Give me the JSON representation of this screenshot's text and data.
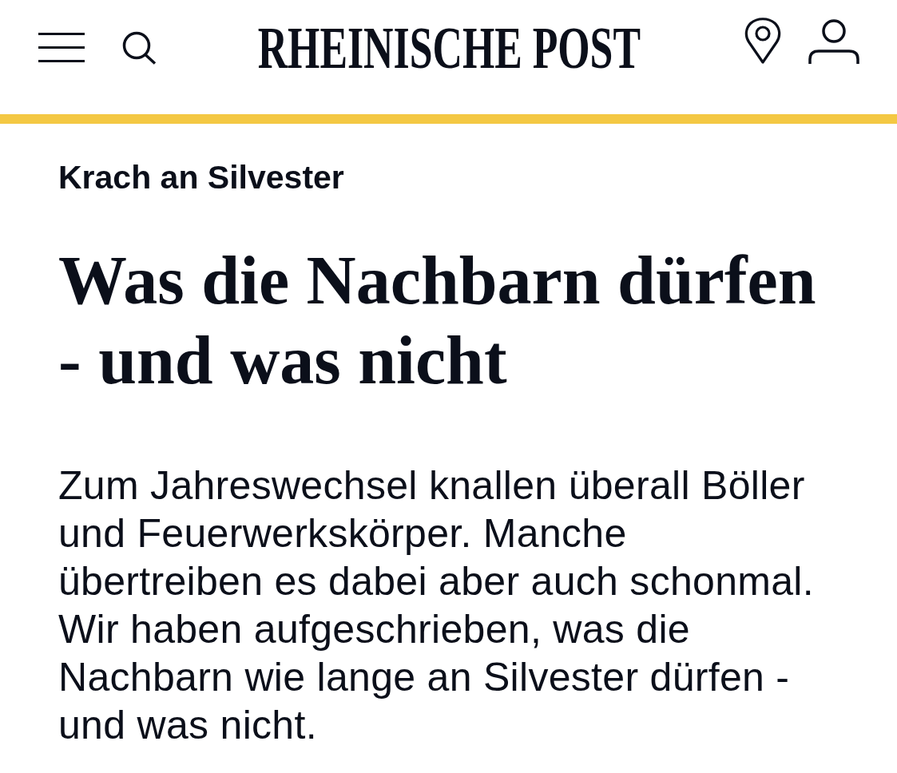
{
  "header": {
    "logo": "RHEINISCHE POST"
  },
  "article": {
    "kicker": "Krach an Silvester",
    "headline": "Was die Nachbarn dürfen - und was nicht",
    "teaser": "Zum Jahreswechsel knallen überall Böller und Feuerwerkskörper. Manche übertreiben es dabei aber auch schonmal. Wir haben aufgeschrieben, was die Nachbarn wie lange an Silvester dürfen - und was nicht."
  }
}
